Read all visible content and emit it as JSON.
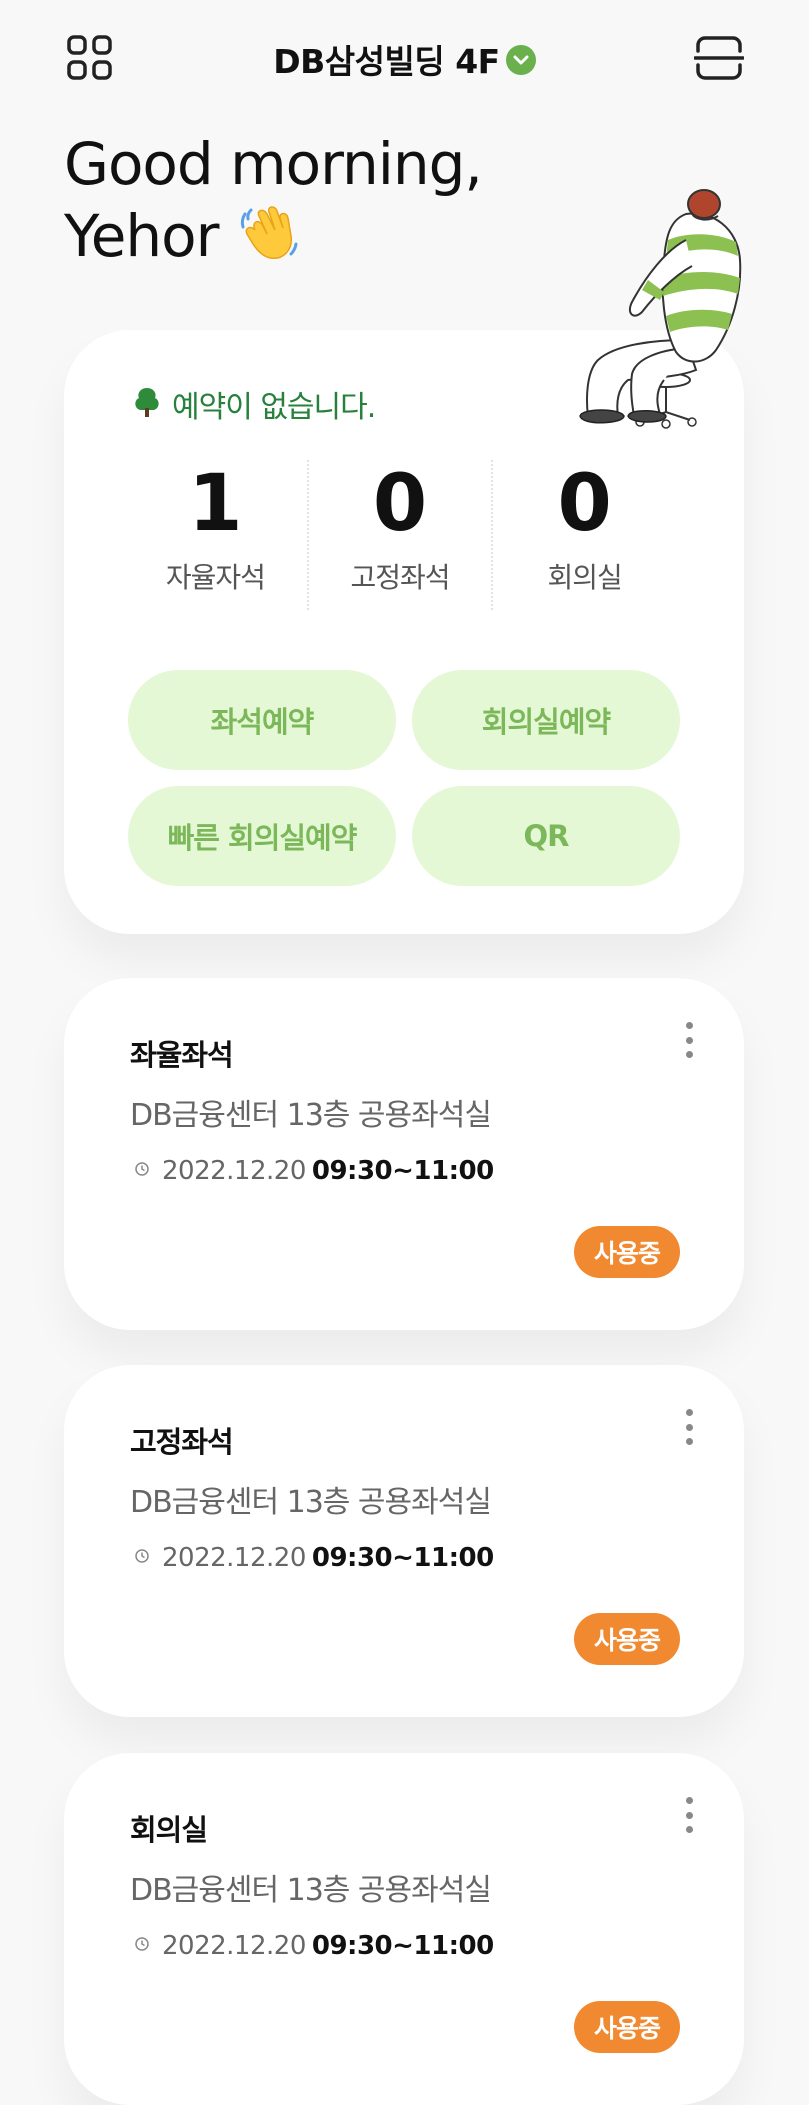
{
  "header": {
    "building": "DB삼성빌딩 4F",
    "menu_icon": "grid-icon",
    "scan_icon": "qr-scan-icon",
    "verified_icon": "chevron-down-icon"
  },
  "greeting": {
    "line1": "Good morning,",
    "line2": "Yehor",
    "emoji": "waving-hand-icon"
  },
  "summary": {
    "notice": "예약이 없습니다.",
    "stats": [
      {
        "value": "1",
        "label": "자율자석"
      },
      {
        "value": "0",
        "label": "고정좌석"
      },
      {
        "value": "0",
        "label": "회의실"
      }
    ],
    "actions": [
      "좌석예약",
      "회의실예약",
      "빠른 회의실예약",
      "QR"
    ]
  },
  "bookings": [
    {
      "title": "좌율좌석",
      "location": "DB금융센터 13층 공용좌석실",
      "date": "2022.12.20",
      "time": "09:30~11:00",
      "status": "사용중"
    },
    {
      "title": "고정좌석",
      "location": "DB금융센터 13층 공용좌석실",
      "date": "2022.12.20",
      "time": "09:30~11:00",
      "status": "사용중"
    },
    {
      "title": "회의실",
      "location": "DB금융센터 13층 공용좌석실",
      "date": "2022.12.20",
      "time": "09:30~11:00",
      "status": "사용중"
    }
  ],
  "colors": {
    "accent_green": "#6ab04c",
    "notice_green": "#27813c",
    "button_bg": "#e5f8d6",
    "button_text": "#7cb85a",
    "status_orange": "#f0892f"
  }
}
